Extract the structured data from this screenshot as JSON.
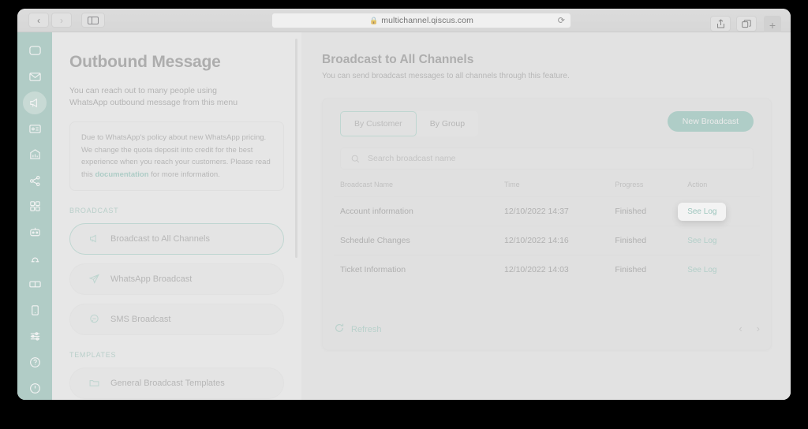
{
  "browser": {
    "back_label": "‹",
    "forward_label": "›",
    "sidebar_toggle_name": "sidebar-toggle",
    "lock_icon": "lock-icon",
    "url": "multichannel.qiscus.com",
    "reload_label": "⟳",
    "share_label": "share-icon",
    "tabs_label": "tabs-icon",
    "new_tab_label": "+"
  },
  "rail": {
    "items": [
      {
        "icon": "chat-bubble-icon",
        "active": false
      },
      {
        "icon": "envelope-icon",
        "active": false
      },
      {
        "icon": "megaphone-icon",
        "active": true
      },
      {
        "icon": "contact-card-icon",
        "active": false
      },
      {
        "icon": "analytics-icon",
        "active": false
      },
      {
        "icon": "share-network-icon",
        "active": false
      },
      {
        "icon": "apps-grid-icon",
        "active": false
      },
      {
        "icon": "robot-icon",
        "active": false
      },
      {
        "icon": "agent-icon",
        "active": false
      },
      {
        "icon": "ticket-icon",
        "active": false
      },
      {
        "icon": "mobile-device-icon",
        "active": false
      },
      {
        "icon": "sliders-icon",
        "active": false
      },
      {
        "icon": "help-circle-icon",
        "active": false
      },
      {
        "icon": "power-icon",
        "active": false
      }
    ]
  },
  "left_panel": {
    "title": "Outbound Message",
    "description": "You can reach out to many people using WhatsApp outbound message from this menu",
    "notice": {
      "text_before": "Due to WhatsApp's policy about new WhatsApp pricing. We change the quota deposit into credit for the best experience when you reach your customers. Please read this ",
      "link_text": "documentation",
      "text_after": " for more information."
    },
    "broadcast_section_label": "BROADCAST",
    "broadcast_items": [
      {
        "label": "Broadcast to All Channels",
        "icon": "megaphone-icon",
        "active": true
      },
      {
        "label": "WhatsApp Broadcast",
        "icon": "paper-plane-icon",
        "active": false
      },
      {
        "label": "SMS Broadcast",
        "icon": "sms-chat-icon",
        "active": false
      }
    ],
    "templates_section_label": "TEMPLATES",
    "template_items": [
      {
        "label": "General Broadcast Templates",
        "icon": "folder-icon",
        "active": false
      }
    ]
  },
  "main": {
    "title": "Broadcast to All Channels",
    "subtitle": "You can send broadcast messages to all channels through this feature.",
    "tabs": [
      {
        "label": "By Customer",
        "active": true
      },
      {
        "label": "By Group",
        "active": false
      }
    ],
    "new_broadcast_label": "New Broadcast",
    "search": {
      "placeholder": "Search broadcast name",
      "value": "",
      "icon": "search-icon"
    },
    "table": {
      "headers": [
        "Broadcast Name",
        "Time",
        "Progress",
        "Action"
      ],
      "rows": [
        {
          "name": "Account information",
          "time": "12/10/2022 14:37",
          "progress": "Finished",
          "action": "See Log",
          "highlighted": true
        },
        {
          "name": "Schedule Changes",
          "time": "12/10/2022 14:16",
          "progress": "Finished",
          "action": "See Log",
          "highlighted": false
        },
        {
          "name": "Ticket Information",
          "time": "12/10/2022 14:03",
          "progress": "Finished",
          "action": "See Log",
          "highlighted": false
        }
      ]
    },
    "refresh_label": "Refresh",
    "pager": {
      "prev": "‹",
      "next": "›"
    }
  },
  "colors": {
    "accent": "#8ec0b6",
    "rail": "#92bfb5",
    "link": "#8bbfb4",
    "page_bg": "#e3e3e3"
  }
}
